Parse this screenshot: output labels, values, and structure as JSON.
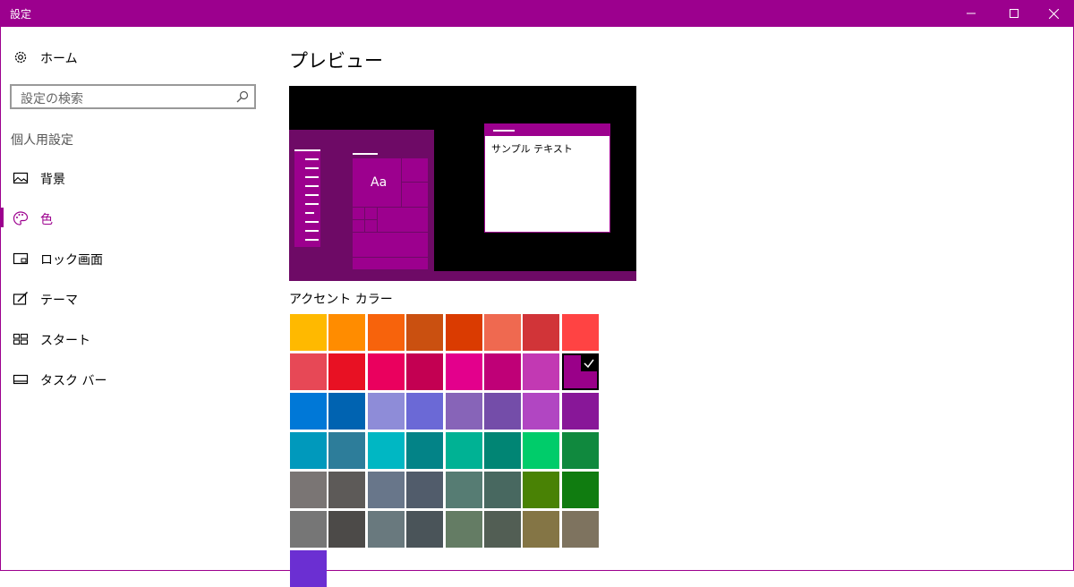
{
  "window": {
    "title": "設定"
  },
  "sidebar": {
    "home_label": "ホーム",
    "search_placeholder": "設定の検索",
    "section_title": "個人用設定",
    "items": [
      {
        "label": "背景",
        "icon": "picture-icon"
      },
      {
        "label": "色",
        "icon": "palette-icon",
        "selected": true
      },
      {
        "label": "ロック画面",
        "icon": "lock-screen-icon"
      },
      {
        "label": "テーマ",
        "icon": "theme-icon"
      },
      {
        "label": "スタート",
        "icon": "start-icon"
      },
      {
        "label": "タスク バー",
        "icon": "taskbar-icon"
      }
    ]
  },
  "main": {
    "title": "プレビュー",
    "preview": {
      "sample_text": "サンプル テキスト",
      "tile_text": "Aa"
    },
    "accent_label": "アクセント カラー",
    "accent_colors": [
      [
        "#FFB900",
        "#FF8C00",
        "#F7630C",
        "#CA5010",
        "#DA3B01",
        "#EF6950",
        "#D13438",
        "#FF4343"
      ],
      [
        "#E74856",
        "#E81123",
        "#EA005E",
        "#C30052",
        "#E3008C",
        "#BF0077",
        "#C239B3",
        "#9A0089"
      ],
      [
        "#0078D7",
        "#0063B1",
        "#8E8CD8",
        "#6B69D6",
        "#8764B8",
        "#744DA9",
        "#B146C2",
        "#881798"
      ],
      [
        "#0099BC",
        "#2D7D9A",
        "#00B7C3",
        "#038387",
        "#00B294",
        "#018574",
        "#00CC6A",
        "#10893E"
      ],
      [
        "#7A7574",
        "#5D5A58",
        "#68768A",
        "#515C6B",
        "#567C73",
        "#486860",
        "#498205",
        "#107C10"
      ],
      [
        "#767676",
        "#4C4A48",
        "#69797E",
        "#4A5459",
        "#647C64",
        "#525E54",
        "#847545",
        "#7E735F"
      ],
      [
        "#6B2FD2"
      ]
    ],
    "selected_color": "#9A0089"
  },
  "colors": {
    "accent": "#9c008e"
  }
}
